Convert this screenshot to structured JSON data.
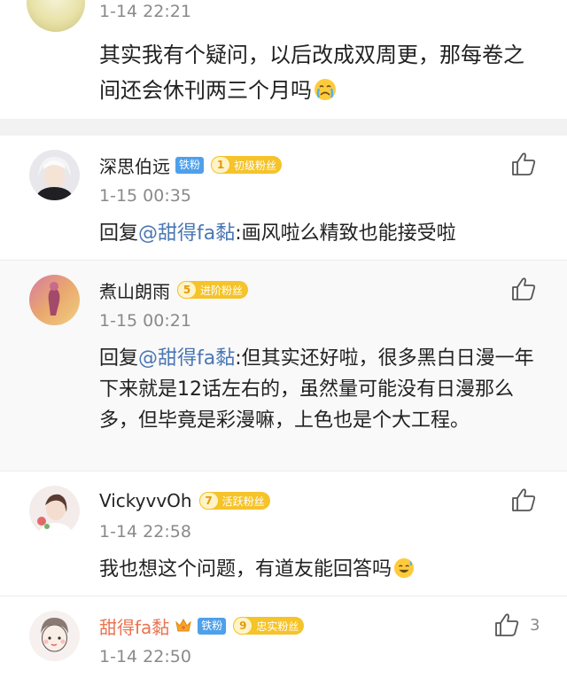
{
  "top_comment": {
    "time": "1-14 22:21",
    "text": "其实我有个疑问，以后改成双周更，那每卷之间还会休刊两三个月吗",
    "emoji_icon": "crying-face-icon"
  },
  "replies": [
    {
      "name": "深思伯远",
      "badge": "铁粉",
      "fan_level": "1",
      "fan_label": "初级粉丝",
      "time": "1-15 00:35",
      "reply_prefix": "回复",
      "mention": "@甜得fa黏",
      "text": ":画风啦么精致也能接受啦"
    },
    {
      "name": "煮山朗雨",
      "fan_level": "5",
      "fan_label": "进阶粉丝",
      "time": "1-15 00:21",
      "reply_prefix": "回复",
      "mention": "@甜得fa黏",
      "text": ":但其实还好啦，很多黑白日漫一年下来就是12话左右的，虽然量可能没有日漫那么多，但毕竟是彩漫嘛，上色也是个大工程。"
    },
    {
      "name": "VickyvvOh",
      "fan_level": "7",
      "fan_label": "活跃粉丝",
      "time": "1-14 22:58",
      "text": "我也想这个问题，有道友能回答吗",
      "emoji_icon": "sweat-smile-icon"
    },
    {
      "name": "甜得fa黏",
      "badge": "铁粉",
      "fan_level": "9",
      "fan_label": "忠实粉丝",
      "time": "1-14 22:50",
      "likes": "3"
    }
  ],
  "colors": {
    "mention": "#4a77b4",
    "owner_name": "#eb7350",
    "fan_badge": "#f5c32a",
    "iron_fan_badge": "#4fa0ea"
  }
}
